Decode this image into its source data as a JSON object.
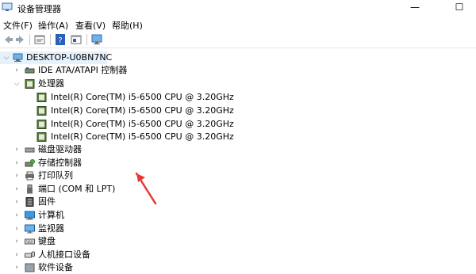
{
  "window": {
    "title": "设备管理器",
    "minimize_glyph": "—",
    "maximize_glyph": "☐"
  },
  "menu": [
    {
      "label": "文件(F)"
    },
    {
      "label": "操作(A)"
    },
    {
      "label": "查看(V)"
    },
    {
      "label": "帮助(H)"
    }
  ],
  "toolbar": {
    "icons": [
      "back-icon",
      "forward-icon",
      "properties-icon",
      "help-icon",
      "show-hidden-icon",
      "monitor-icon"
    ]
  },
  "tree": {
    "root": "DESKTOP-U0BN7NC",
    "nodes": [
      {
        "label": "IDE ATA/ATAPI 控制器",
        "expanded": false,
        "icon": "ide-controller-icon"
      },
      {
        "label": "处理器",
        "expanded": true,
        "icon": "processor-icon",
        "children": [
          "Intel(R) Core(TM) i5-6500 CPU @ 3.20GHz",
          "Intel(R) Core(TM) i5-6500 CPU @ 3.20GHz",
          "Intel(R) Core(TM) i5-6500 CPU @ 3.20GHz",
          "Intel(R) Core(TM) i5-6500 CPU @ 3.20GHz"
        ]
      },
      {
        "label": "磁盘驱动器",
        "expanded": false,
        "icon": "disk-drive-icon"
      },
      {
        "label": "存储控制器",
        "expanded": false,
        "icon": "storage-controller-icon"
      },
      {
        "label": "打印队列",
        "expanded": false,
        "icon": "printer-icon"
      },
      {
        "label": "端口 (COM 和 LPT)",
        "expanded": false,
        "icon": "port-icon"
      },
      {
        "label": "固件",
        "expanded": false,
        "icon": "firmware-icon"
      },
      {
        "label": "计算机",
        "expanded": false,
        "icon": "computer-icon"
      },
      {
        "label": "监视器",
        "expanded": false,
        "icon": "monitor-icon"
      },
      {
        "label": "键盘",
        "expanded": false,
        "icon": "keyboard-icon"
      },
      {
        "label": "人机接口设备",
        "expanded": false,
        "icon": "hid-icon"
      },
      {
        "label": "软件设备",
        "expanded": false,
        "icon": "software-device-icon"
      }
    ]
  },
  "colors": {
    "selection": "#e5f1fb",
    "arrow": "#e53935",
    "chip_green": "#4a7a3a"
  }
}
